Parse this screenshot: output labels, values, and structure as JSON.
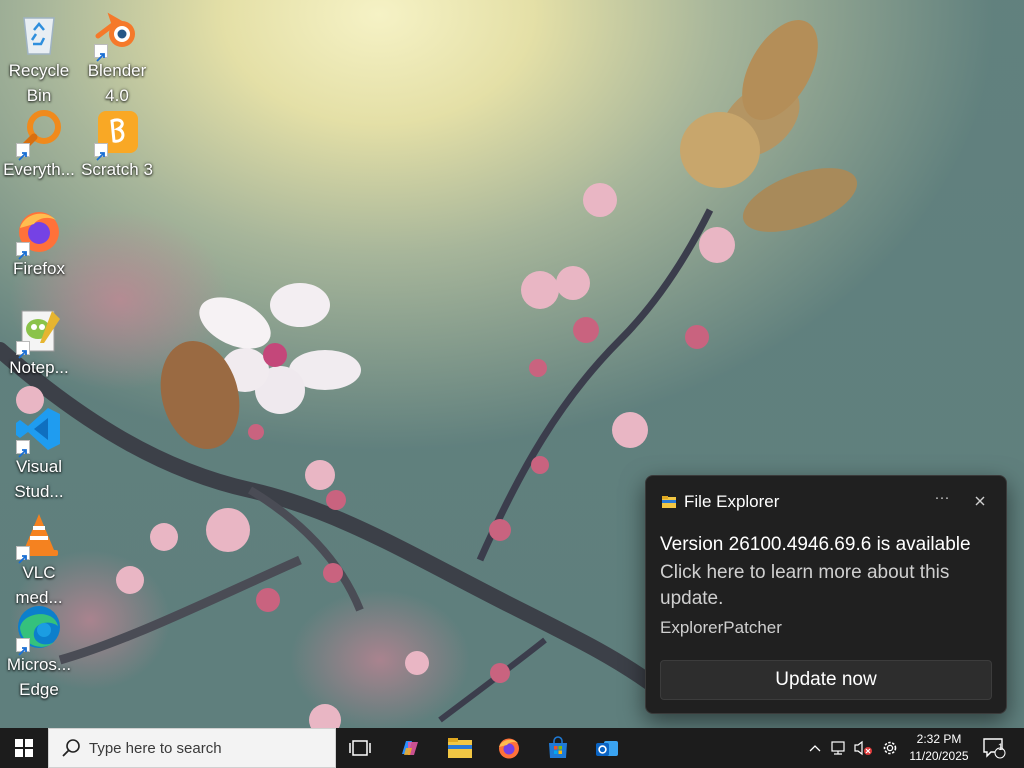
{
  "desktop": {
    "icons": [
      {
        "label": "Recycle\nBin",
        "icon": "recycle-bin-icon"
      },
      {
        "label": "Blender\n4.0",
        "icon": "blender-icon"
      },
      {
        "label": "Everyth...",
        "icon": "everything-search-icon"
      },
      {
        "label": "Scratch 3",
        "icon": "scratch-icon"
      },
      {
        "label": "Firefox",
        "icon": "firefox-icon"
      },
      {
        "label": "Notep...",
        "icon": "notepad-plus-plus-icon"
      },
      {
        "label": "Visual\nStud...",
        "icon": "vscode-icon"
      },
      {
        "label": "VLC\nmed...",
        "icon": "vlc-icon"
      },
      {
        "label": "Micros...\nEdge",
        "icon": "edge-icon"
      }
    ]
  },
  "toast": {
    "app_name": "File Explorer",
    "more_label": "···",
    "title": "Version 26100.4946.69.6 is available",
    "body": "Click here to learn more about this update.",
    "attribution": "ExplorerPatcher",
    "button_label": "Update now"
  },
  "taskbar": {
    "search_placeholder": "Type here to search",
    "pinned": [
      "task-view-icon",
      "copilot-icon",
      "file-explorer-icon",
      "firefox-icon",
      "microsoft-store-icon",
      "outlook-icon"
    ],
    "clock_time": "2:32 PM",
    "clock_date": "11/20/2025",
    "notification_count": "1"
  },
  "colors": {
    "taskbar": "#1c1c1c",
    "toast_bg": "#202020",
    "toast_button": "#2d2d2d"
  }
}
